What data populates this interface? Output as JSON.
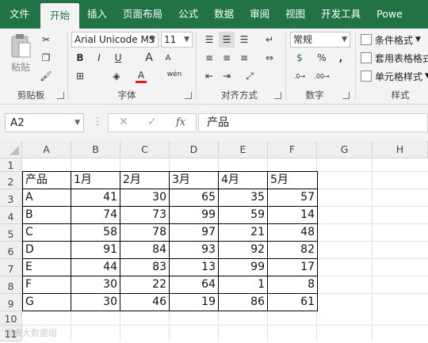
{
  "menu": {
    "tabs": [
      "文件",
      "开始",
      "插入",
      "页面布局",
      "公式",
      "数据",
      "审阅",
      "视图",
      "开发工具",
      "Powe"
    ],
    "active": "开始"
  },
  "ribbon": {
    "clipboard": {
      "paste_label": "粘贴",
      "group_label": "剪贴板"
    },
    "font": {
      "font_name": "Arial Unicode MS",
      "font_size": "11",
      "bold": "B",
      "italic": "I",
      "underline": "U",
      "grow": "A",
      "shrink": "A",
      "font_color_label": "A",
      "phonetic": "wén",
      "group_label": "字体",
      "font_color": "#e31a1c"
    },
    "alignment": {
      "group_label": "对齐方式"
    },
    "number": {
      "format": "常规",
      "currency": "$",
      "percent": "%",
      "comma": ",",
      "group_label": "数字"
    },
    "styles": {
      "conditional": "条件格式",
      "table_format": "套用表格格式",
      "cell_styles": "单元格样式",
      "group_label": "样式"
    }
  },
  "formula_bar": {
    "name_box": "A2",
    "fx": "fx",
    "content": "产品"
  },
  "sheet": {
    "columns": [
      "A",
      "B",
      "C",
      "D",
      "E",
      "F",
      "G",
      "H"
    ],
    "rows": [
      "1",
      "2",
      "3",
      "4",
      "5",
      "6",
      "7",
      "8",
      "9",
      "10",
      "11"
    ],
    "header_row": [
      "产品",
      "1月",
      "2月",
      "3月",
      "4月",
      "5月"
    ],
    "data": [
      [
        "A",
        "41",
        "30",
        "65",
        "35",
        "57"
      ],
      [
        "B",
        "74",
        "73",
        "99",
        "59",
        "14"
      ],
      [
        "C",
        "58",
        "78",
        "97",
        "21",
        "48"
      ],
      [
        "D",
        "91",
        "84",
        "93",
        "92",
        "82"
      ],
      [
        "E",
        "44",
        "83",
        "13",
        "99",
        "17"
      ],
      [
        "F",
        "30",
        "22",
        "64",
        "1",
        "8"
      ],
      [
        "G",
        "30",
        "46",
        "19",
        "86",
        "61"
      ]
    ],
    "watermark": "图表大数据组"
  },
  "colors": {
    "brand": "#217346",
    "ribbon_bg": "#f3f3f3",
    "header_bg": "#efefef"
  }
}
